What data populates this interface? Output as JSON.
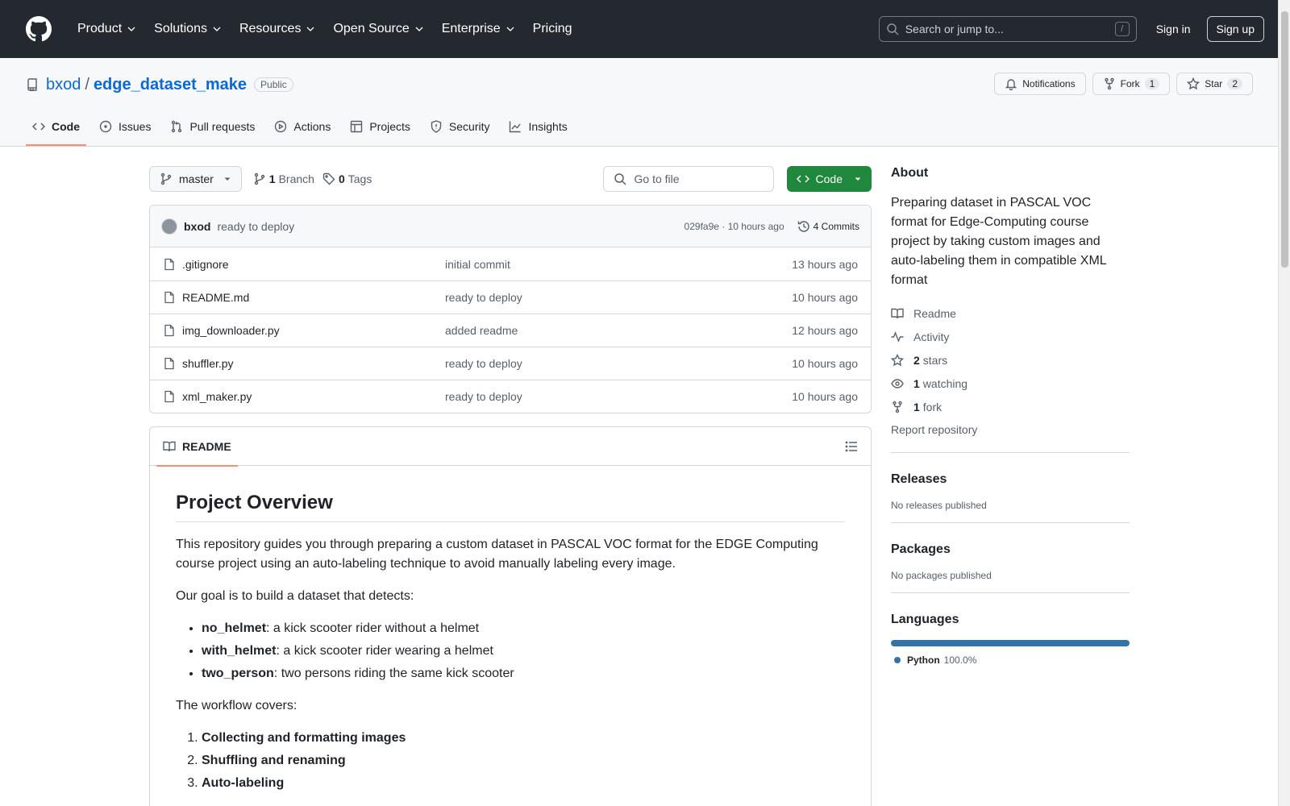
{
  "header": {
    "nav": [
      "Product",
      "Solutions",
      "Resources",
      "Open Source",
      "Enterprise",
      "Pricing"
    ],
    "search_placeholder": "Search or jump to...",
    "search_kbd": "/",
    "signin": "Sign in",
    "signup": "Sign up"
  },
  "repo": {
    "owner": "bxod",
    "sep": "/",
    "name": "edge_dataset_make",
    "visibility": "Public",
    "notifications": "Notifications",
    "fork_label": "Fork",
    "fork_count": "1",
    "star_label": "Star",
    "star_count": "2"
  },
  "tabs": [
    "Code",
    "Issues",
    "Pull requests",
    "Actions",
    "Projects",
    "Security",
    "Insights"
  ],
  "toolbar": {
    "branch": "master",
    "branch_count": "1",
    "branch_label": "Branch",
    "tag_count": "0",
    "tag_label": "Tags",
    "goto_placeholder": "Go to file",
    "code_label": "Code"
  },
  "commit": {
    "author": "bxod",
    "message": "ready to deploy",
    "hash_time": "029fa9e · 10 hours ago",
    "commits": "4 Commits"
  },
  "files": [
    {
      "name": ".gitignore",
      "message": "initial commit",
      "time": "13 hours ago"
    },
    {
      "name": "README.md",
      "message": "ready to deploy",
      "time": "10 hours ago"
    },
    {
      "name": "img_downloader.py",
      "message": "added readme",
      "time": "12 hours ago"
    },
    {
      "name": "shuffler.py",
      "message": "ready to deploy",
      "time": "10 hours ago"
    },
    {
      "name": "xml_maker.py",
      "message": "ready to deploy",
      "time": "10 hours ago"
    }
  ],
  "readme": {
    "tab": "README",
    "title": "Project Overview",
    "intro": "This repository guides you through preparing a custom dataset in PASCAL VOC format for the EDGE Computing course project using an auto-labeling technique to avoid manually labeling every image.",
    "goal": "Our goal is to build a dataset that detects:",
    "classes": [
      {
        "key": "no_helmet",
        "desc": ": a kick scooter rider without a helmet"
      },
      {
        "key": "with_helmet",
        "desc": ": a kick scooter rider wearing a helmet"
      },
      {
        "key": "two_person",
        "desc": ": two persons riding the same kick scooter"
      }
    ],
    "workflow": "The workflow covers:",
    "steps": [
      "Collecting and formatting images",
      "Shuffling and renaming",
      "Auto-labeling"
    ]
  },
  "about": {
    "title": "About",
    "description": "Preparing dataset in PASCAL VOC format for Edge-Computing course project by taking custom images and auto-labeling them in compatible XML format",
    "readme": "Readme",
    "activity": "Activity",
    "stars_count": "2",
    "stars_label": "stars",
    "watching_count": "1",
    "watching_label": "watching",
    "forks_count": "1",
    "forks_label": "fork",
    "report": "Report repository"
  },
  "releases": {
    "title": "Releases",
    "text": "No releases published"
  },
  "packages": {
    "title": "Packages",
    "text": "No packages published"
  },
  "languages": {
    "title": "Languages",
    "name": "Python",
    "percent": "100.0%",
    "color": "#3572a5"
  },
  "colors": {
    "header_bg": "#24292f",
    "link": "#0969da",
    "code_button": "#1f883d",
    "tab_underline": "#fd8c73"
  }
}
